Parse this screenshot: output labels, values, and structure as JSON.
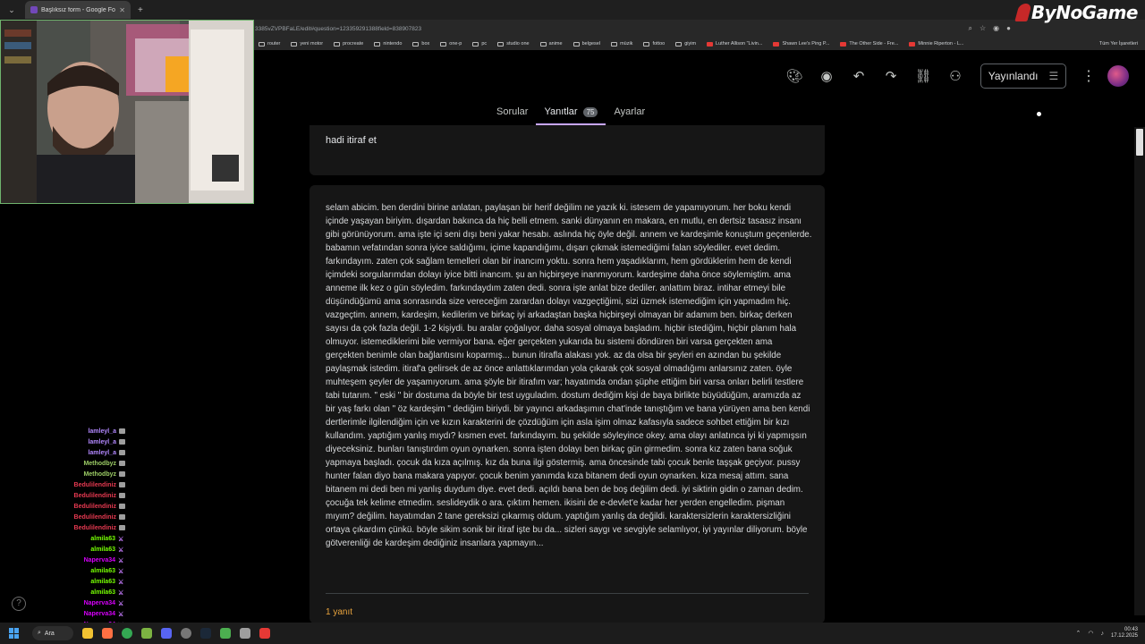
{
  "browser": {
    "tab_title": "Başlıksız form - Google Formlar",
    "url": "3385vZVPBFaLE/edit#question=123359291388field=838907823",
    "bookmarks": [
      {
        "label": "router",
        "kind": "folder"
      },
      {
        "label": "yeni motor",
        "kind": "folder"
      },
      {
        "label": "procreate",
        "kind": "folder"
      },
      {
        "label": "nintendo",
        "kind": "folder"
      },
      {
        "label": "box",
        "kind": "folder"
      },
      {
        "label": "one-p",
        "kind": "folder"
      },
      {
        "label": "pc",
        "kind": "folder"
      },
      {
        "label": "studio one",
        "kind": "folder"
      },
      {
        "label": "anime",
        "kind": "folder"
      },
      {
        "label": "belgesel",
        "kind": "folder"
      },
      {
        "label": "müzik",
        "kind": "folder"
      },
      {
        "label": "fottoo",
        "kind": "folder"
      },
      {
        "label": "giyim",
        "kind": "folder"
      },
      {
        "label": "Luther Allison \"Livin...",
        "kind": "youtube"
      },
      {
        "label": "Shawn Lee's Ping P...",
        "kind": "youtube"
      },
      {
        "label": "The Other Side - Fre...",
        "kind": "youtube"
      },
      {
        "label": "Minnie Riperton - L...",
        "kind": "youtube"
      }
    ],
    "all_bookmarks": "Tüm Yer İşaretleri"
  },
  "logo": "ByNoGame",
  "toolbar": {
    "publish_label": "Yayınlandı"
  },
  "tabs": [
    {
      "label": "Sorular",
      "active": false
    },
    {
      "label": "Yanıtlar",
      "active": true,
      "count": "75"
    },
    {
      "label": "Ayarlar",
      "active": false
    }
  ],
  "question": "hadi itiraf et",
  "answer": "selam abicim. ben derdini birine anlatan, paylaşan bir herif değilim ne yazık ki. istesem de yapamıyorum. her boku kendi içinde yaşayan biriyim. dışardan bakınca da hiç belli etmem. sanki dünyanın en makara, en mutlu, en dertsiz tasasız insanı gibi görünüyorum. ama işte içi seni dışı beni yakar hesabı. aslında hiç öyle değil. annem ve kardeşimle konuştum geçenlerde. babamın vefatından sonra iyice saldığımı, içime kapandığımı, dışarı çıkmak istemediğimi falan söylediler. evet dedim. farkındayım. zaten çok sağlam temelleri olan bir inancım yoktu. sonra hem yaşadıklarım, hem gördüklerim hem de kendi içimdeki sorgularımdan dolayı iyice bitti inancım. şu an hiçbirşeye inanmıyorum. kardeşime daha önce söylemiştim. ama anneme ilk kez o gün söyledim. farkındaydım zaten dedi. sonra işte anlat bize dediler. anlattım biraz. intihar etmeyi bile düşündüğümü ama sonrasında size vereceğim zarardan dolayı vazgeçtiğimi, sizi üzmek istemediğim için yapmadım hiç. vazgeçtim. annem, kardeşim, kedilerim ve birkaç iyi arkadaştan başka hiçbirşeyi olmayan bir adamım ben. birkaç derken sayısı da çok fazla değil. 1-2 kişiydi. bu aralar çoğalıyor. daha sosyal olmaya başladım. hiçbir istediğim, hiçbir planım hala olmuyor. istemediklerimi bile vermiyor bana. eğer gerçekten yukarıda bu sistemi döndüren biri varsa gerçekten ama gerçekten benimle olan bağlantısını koparmış... bunun itirafla alakası yok. az da olsa bir şeyleri en azından bu şekilde paylaşmak istedim. itiraf'a gelirsek de az önce anlattıklarımdan yola çıkarak çok sosyal olmadığımı anlarsınız zaten. öyle muhteşem şeyler de yaşamıyorum. ama şöyle bir itirafım var; hayatımda ondan şüphe ettiğim biri varsa onları belirli testlere tabi tutarım. \" eski \" bir dostuma da böyle bir test uyguladım. dostum dediğim kişi de baya birlikte büyüdüğüm, aramızda az bir yaş farkı olan \" öz kardeşim \" dediğim biriydi. bir yayıncı arkadaşımın chat'inde tanıştığım ve bana yürüyen ama ben kendi dertlerimle ilgilendiğim için ve kızın karakterini de çözdüğüm için asla işim olmaz kafasıyla sadece sohbet ettiğim bir kızı kullandım. yaptığım yanlış mıydı? kısmen evet. farkındayım. bu şekilde söyleyince okey. ama olayı anlatınca iyi ki yapmışsın diyeceksiniz. bunları tanıştırdım oyun oynarken. sonra işten dolayı ben birkaç gün girmedim. sonra kız zaten bana soğuk yapmaya başladı. çocuk da kıza açılmış. kız da buna ilgi göstermiş. ama öncesinde tabi çocuk benle taşşak geçiyor. pussy hunter falan diyo bana makara yapıyor. çocuk benim yanımda kıza bitanem dedi oyun oynarken. kıza mesaj attım. sana bitanem mi dedi ben mi yanlış duydum diye. evet dedi. açıldı bana ben de boş değilim dedi. iyi siktirin gidin o zaman dedim. çocuğa tek kelime etmedim. seslideydik o ara. çıktım hemen. ikisini de e-devlet'e kadar her yerden engelledim. pişman mıyım? değilim. hayatımdan 2 tane gereksizi çıkarmış oldum. yaptığım yanlış da değildi. karaktersizlerin karaktersizliğini ortaya çıkardım çünkü. böyle sikim sonik bir itiraf işte bu da... sizleri saygı ve sevgiyle selamlıyor, iyi yayınlar diliyorum. böyle götverenliği de kardeşim dediğiniz insanlara yapmayın...",
  "replies": "1 yanıt",
  "chat": [
    {
      "user": "lamleyl_a",
      "color": "#b388ff",
      "badge": "gray"
    },
    {
      "user": "lamleyl_a",
      "color": "#b388ff",
      "badge": "gray"
    },
    {
      "user": "lamleyl_a",
      "color": "#b388ff",
      "badge": "gray"
    },
    {
      "user": "Methodbyz",
      "color": "#9ccc65",
      "badge": "gray"
    },
    {
      "user": "Methodbyz",
      "color": "#9ccc65",
      "badge": "gray"
    },
    {
      "user": "Bedulilendiniz",
      "color": "#e53950",
      "badge": "gray"
    },
    {
      "user": "Bedulilendiniz",
      "color": "#e53950",
      "badge": "gray"
    },
    {
      "user": "Bedulilendiniz",
      "color": "#e53950",
      "badge": "gray"
    },
    {
      "user": "Bedulilendiniz",
      "color": "#e53950",
      "badge": "gray"
    },
    {
      "user": "Bedulilendiniz",
      "color": "#e53950",
      "badge": "gray"
    },
    {
      "user": "almila63",
      "color": "#76ff03",
      "badge": "sword"
    },
    {
      "user": "almila63",
      "color": "#76ff03",
      "badge": "sword"
    },
    {
      "user": "Naperva34",
      "color": "#d500f9",
      "badge": "sword"
    },
    {
      "user": "almila63",
      "color": "#76ff03",
      "badge": "sword"
    },
    {
      "user": "almila63",
      "color": "#76ff03",
      "badge": "sword"
    },
    {
      "user": "almila63",
      "color": "#76ff03",
      "badge": "sword"
    },
    {
      "user": "Naperva34",
      "color": "#d500f9",
      "badge": "sword"
    },
    {
      "user": "Naperva34",
      "color": "#d500f9",
      "badge": "sword"
    },
    {
      "user": "Naperva34",
      "color": "#d500f9",
      "badge": "sword"
    }
  ],
  "taskbar": {
    "search_label": "Ara",
    "time": "00:43",
    "date": "17.12.2025"
  },
  "colors": {
    "accent": "#c8a6ff",
    "replies": "#e8a33d"
  }
}
